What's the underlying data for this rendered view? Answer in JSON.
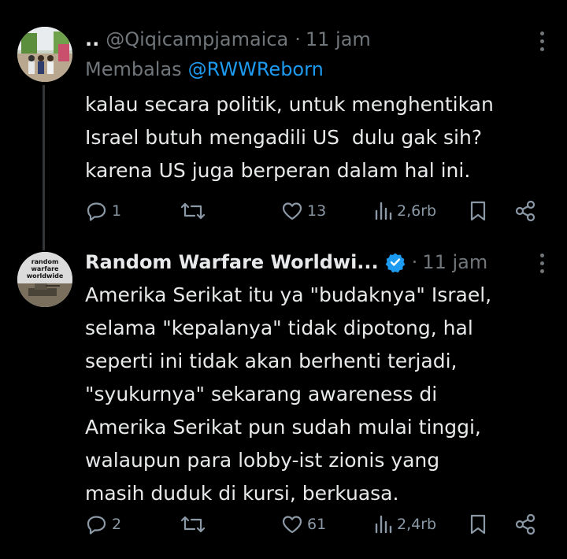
{
  "tweets": [
    {
      "display_name": "..",
      "handle": "@Qiqicampjamaica",
      "separator": "·",
      "time": "11 jam",
      "reply_prefix": "Membalas",
      "reply_to": "@RWWReborn",
      "text": "kalau secara politik, untuk menghentikan\nIsrael butuh mengadili US  dulu gak sih?\nkarena US juga berperan dalam hal ini.",
      "replies": "1",
      "reposts": "",
      "likes": "13",
      "views": "2,6rb"
    },
    {
      "display_name": "Random Warfare Worldwi...",
      "separator": "·",
      "time": "11 jam",
      "avatar_text": "random warfare worldwide",
      "text": "Amerika Serikat itu ya \"budaknya\" Israel,\nselama \"kepalanya\" tidak dipotong, hal\nseperti ini tidak akan berhenti terjadi,\n\"syukurnya\" sekarang awareness di\nAmerika Serikat pun sudah mulai tinggi,\nwalaupun para lobby-ist zionis yang\nmasih duduk di kursi, berkuasa.",
      "replies": "2",
      "reposts": "",
      "likes": "61",
      "views": "2,4rb"
    }
  ],
  "colors": {
    "background": "#000000",
    "text": "#e7e9ea",
    "muted": "#71767b",
    "accent": "#1d9bf0",
    "thread_line": "#333639"
  },
  "icons": [
    "more-icon",
    "reply-icon",
    "repost-icon",
    "like-icon",
    "views-icon",
    "bookmark-icon",
    "share-icon",
    "verified-badge-icon"
  ]
}
